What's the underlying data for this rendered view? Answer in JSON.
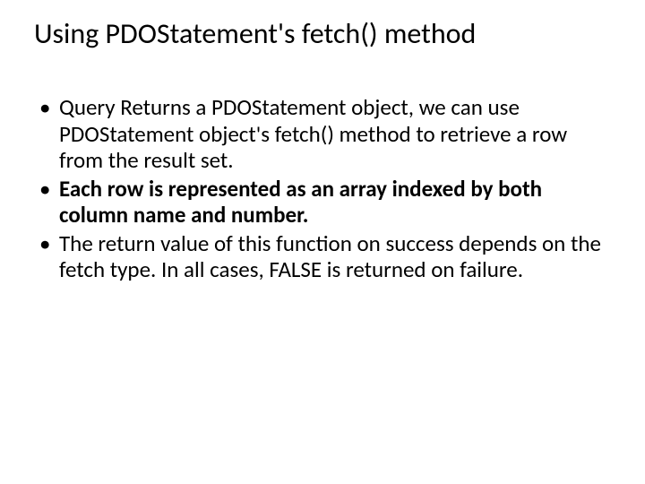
{
  "slide": {
    "title": "Using PDOStatement's fetch() method",
    "bullets": [
      {
        "text": "Query Returns a PDOStatement object, we can use PDOStatement object's fetch() method to retrieve a row from the result set.",
        "bold": false
      },
      {
        "text": "Each row is represented as an array indexed by both column name and number.",
        "bold": true
      },
      {
        "text": "The return value of this function on success depends on the fetch type. In all cases, FALSE is returned on failure.",
        "bold": false
      }
    ]
  }
}
